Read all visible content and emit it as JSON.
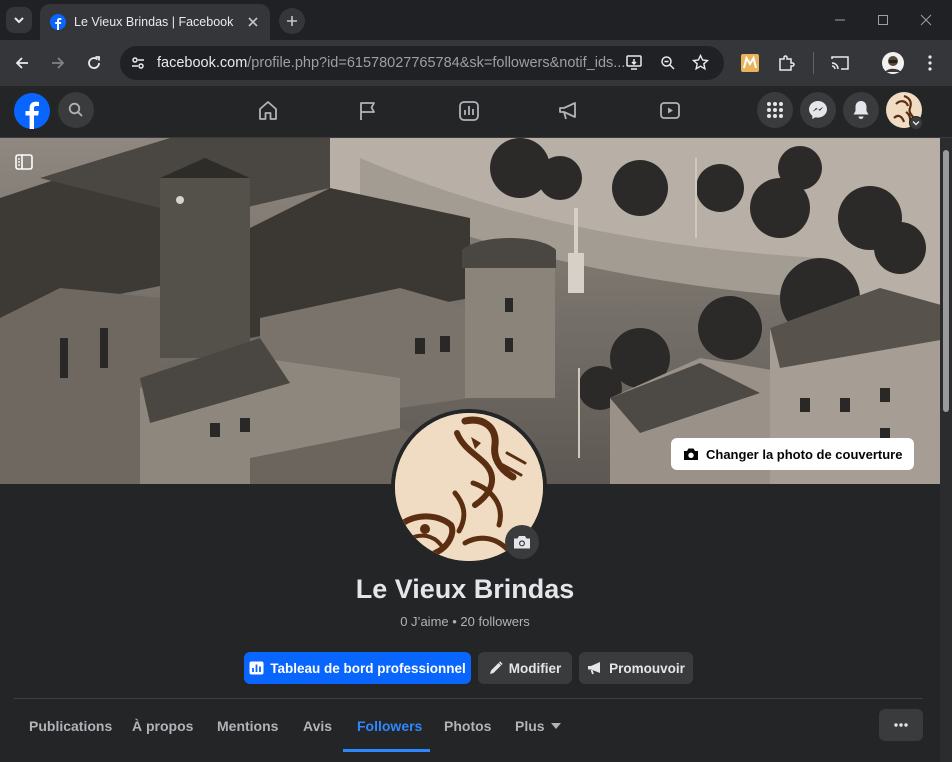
{
  "browser": {
    "tab_title": "Le Vieux Brindas | Facebook",
    "url_host": "facebook.com",
    "url_rest": "/profile.php?id=61578027765784&sk=followers&notif_ids..."
  },
  "page": {
    "name": "Le Vieux Brindas",
    "stats": "0 J’aime • 20 followers",
    "cover_button_label": "Changer la photo de couverture"
  },
  "actions": {
    "dashboard": "Tableau de bord professionnel",
    "edit": "Modifier",
    "promote": "Promouvoir"
  },
  "tabs": [
    "Publications",
    "À propos",
    "Mentions",
    "Avis",
    "Followers",
    "Photos",
    "Plus"
  ],
  "active_tab": "Followers",
  "colors": {
    "accent": "#0866ff",
    "active_tab": "#2d88ff",
    "background": "#242526"
  }
}
